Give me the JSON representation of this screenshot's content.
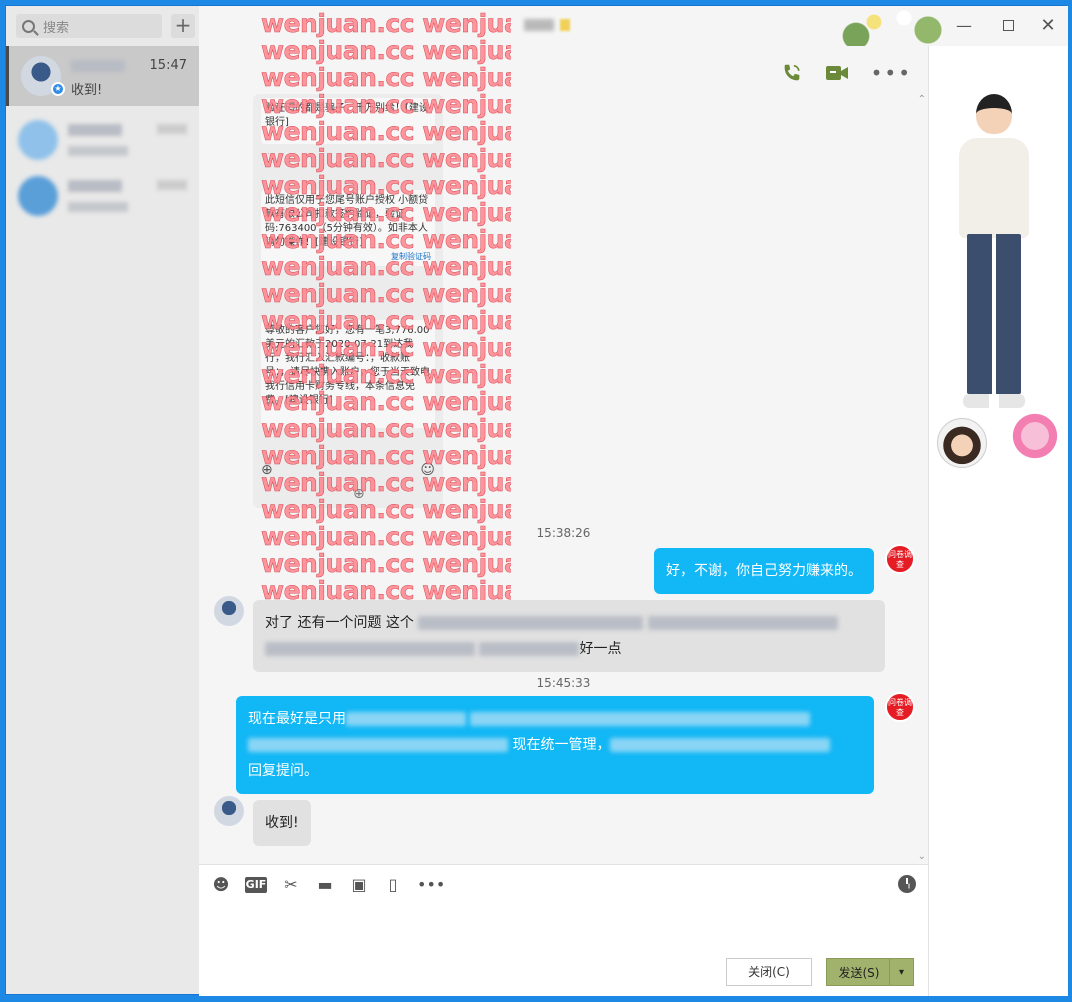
{
  "sidebar": {
    "search_placeholder": "搜索",
    "add_label": "+",
    "conversations": [
      {
        "time": "15:47",
        "last_message": "收到!"
      }
    ]
  },
  "titlebar": {
    "min_label": "—",
    "close_label": "✕"
  },
  "chat": {
    "more_label": "•••",
    "image_message": {
      "sms": [
        "验证码的都是骗子，千万别给！[建设银行]",
        "此短信仅用于您尾号账户授权 小额贷款有限公司扣款签约验证，验证码:763400（5分钟有效）。如非本人请勿操作！[建设银行]",
        "尊敬的客户您好，您有一笔3,776.00美元的汇款于2020-07-21到达我行，我行汇入汇款编号：，收款账号：，请尽快携入账户，您于当天致电我行信用卡财务专线，本条信息免费。[建设银行]"
      ],
      "copy_link": "复制验证码"
    },
    "watermark_text": "wenjuan.cc wenjuan.cc",
    "messages": [
      {
        "type": "time",
        "text": "15:38:26"
      },
      {
        "type": "out",
        "text": "好，不谢，你自己努力赚来的。",
        "badge": "问卷调查"
      },
      {
        "type": "in",
        "text_start": "对了  还有一个问题  这个",
        "text_end": "好一点"
      },
      {
        "type": "time",
        "text": "15:45:33"
      },
      {
        "type": "out",
        "text_start": "现在最好是只用",
        "text_mid": "现在统一管理，",
        "text_end": "回复提问。",
        "badge": "问卷调查"
      },
      {
        "type": "in",
        "text": "收到!"
      }
    ]
  },
  "composer": {
    "gif_label": "GIF",
    "more_label": "•••",
    "close_button": "关闭(C)",
    "send_button": "发送(S)",
    "send_arrow": "▾"
  },
  "colors": {
    "accent": "#12b7f5",
    "send_button": "#a0b26c",
    "badge": "#e51c23"
  }
}
